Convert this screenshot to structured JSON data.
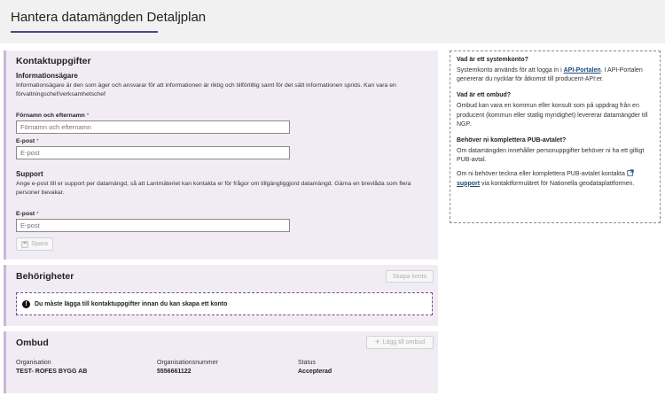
{
  "header": {
    "title": "Hantera datamängden Detaljplan"
  },
  "contact": {
    "title": "Kontaktuppgifter",
    "owner": {
      "heading": "Informationsägare",
      "description": "Informationsägare är den som äger och ansvarar för att informationen är riktig och tillförlitlig samt för det sätt informationen sprids. Kan vara en förvaltningschef/verksamhetschef",
      "name_label": "Förnamn och efternamn",
      "name_placeholder": "Förnamn och efternamn",
      "email_label": "E-post",
      "email_placeholder": "E-post"
    },
    "support": {
      "heading": "Support",
      "description": "Ange e-post till er support per datamängd, så att Lantmäteriet kan kontakta er för frågor om tillgängliggjord datamängd. Gärna en brevlåda som flera personer bevakar.",
      "email_label": "E-post",
      "email_placeholder": "E-post"
    },
    "required_marker": "*",
    "save_label": "Spara"
  },
  "permissions": {
    "title": "Behörigheter",
    "create_account_label": "Skapa konto",
    "notice": "Du måste lägga till kontaktuppgifter innan du kan skapa ett konto"
  },
  "ombud": {
    "title": "Ombud",
    "add_label": "Lägg till ombud",
    "columns": [
      "Organisation",
      "Organisationsnummer",
      "Status"
    ],
    "rows": [
      [
        "TEST- ROFES BYGG AB",
        "5556661122",
        "Accepterad"
      ]
    ]
  },
  "info": {
    "q1": "Vad är ett systemkonto?",
    "a1_pre": "Systemkonto används för att logga in i ",
    "a1_link": "API-Portalen",
    "a1_post": ". I API-Portalen genererar du nycklar för åtkomst till producent-API:er.",
    "q2": "Vad är ett ombud?",
    "a2": "Ombud kan vara en kommun eller konsult som på uppdrag från en producent (kommun eller statlig myndighet) levererar datamängder till NGP.",
    "q3": "Behöver ni komplettera PUB-avtalet?",
    "a3": "Om datamängden innehåller personuppgifter behöver ni ha ett giltigt PUB-avtal.",
    "a4_pre": "Om ni behöver teckna eller komplettera PUB-avtalet kontakta ",
    "a4_link": "support",
    "a4_post": " via kontaktformuläret för Nationella geodataplattformen."
  }
}
